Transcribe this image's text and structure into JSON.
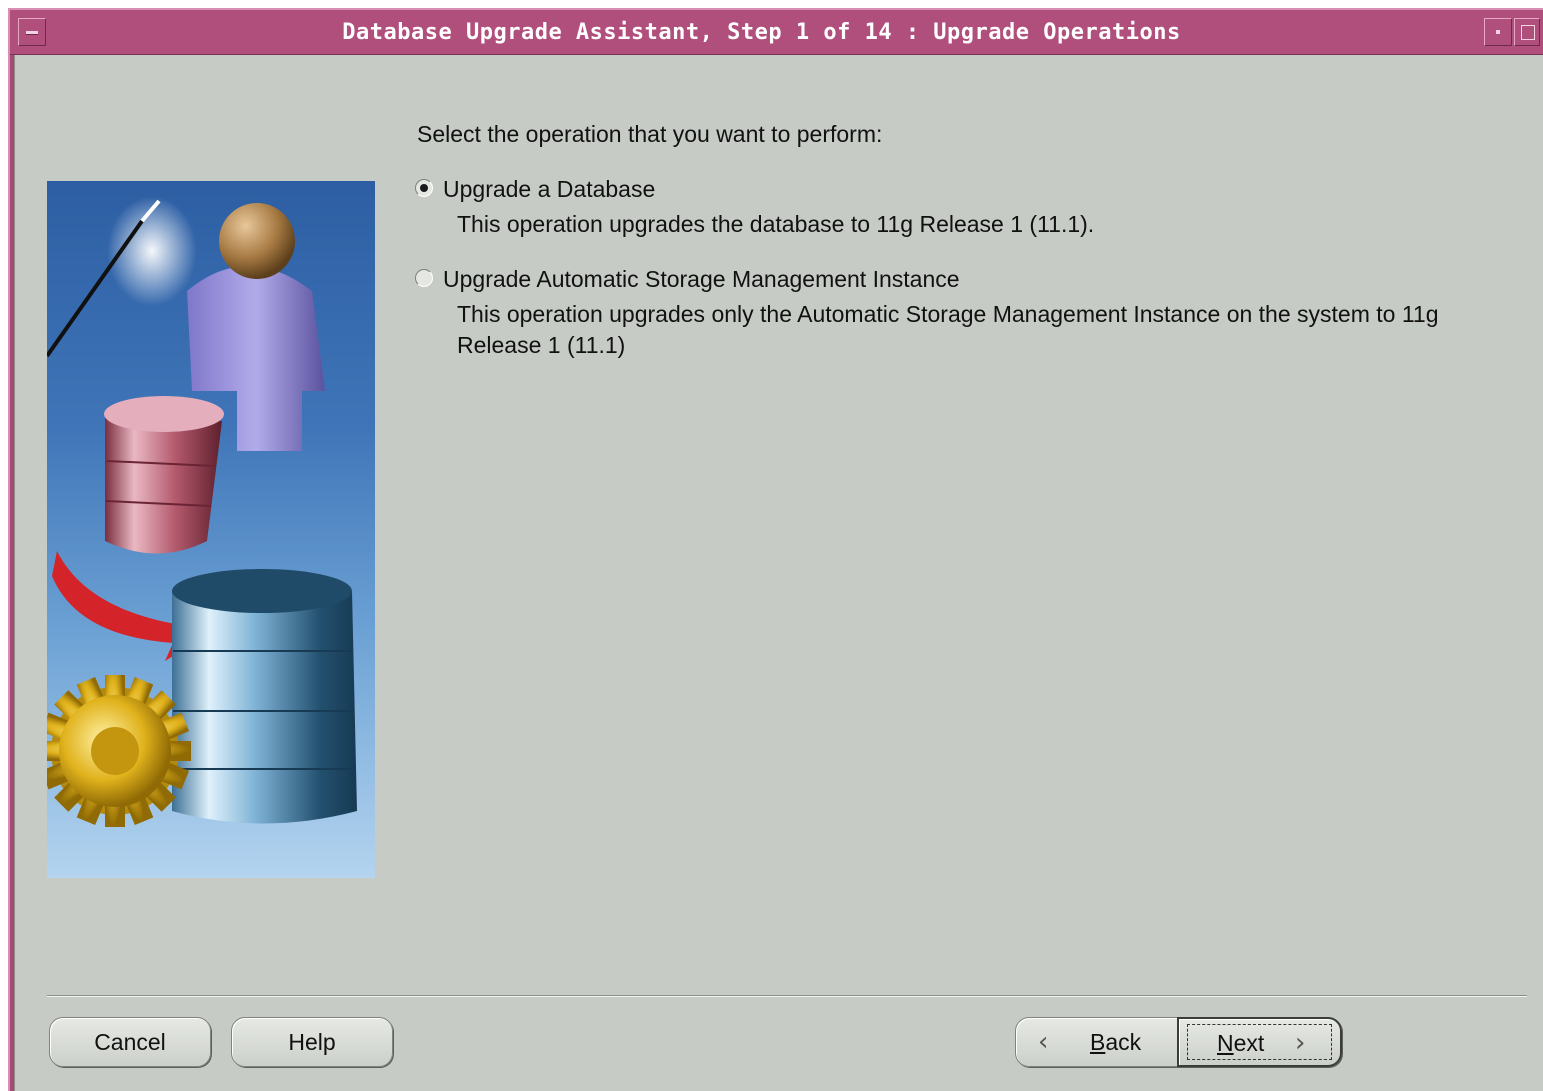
{
  "window": {
    "title": "Database Upgrade Assistant, Step 1 of 14 : Upgrade Operations"
  },
  "content": {
    "prompt": "Select the operation that you want to perform:",
    "options": [
      {
        "label": "Upgrade a Database",
        "description": "This operation upgrades the database to 11g Release 1 (11.1).",
        "selected": true
      },
      {
        "label": "Upgrade Automatic Storage Management Instance",
        "description": "This operation upgrades only the Automatic Storage Management Instance on the system to 11g Release 1 (11.1)",
        "selected": false
      }
    ]
  },
  "buttons": {
    "cancel": "Cancel",
    "help": "Help",
    "back_mnemonic": "B",
    "back_rest": "ack",
    "next_mnemonic": "N",
    "next_rest": "ext"
  },
  "icons": [
    "window-menu-icon",
    "minimize-icon",
    "maximize-icon",
    "back-chevron-icon",
    "next-chevron-icon"
  ],
  "colors": {
    "titlebar": "#b04f7c",
    "client_bg": "#c6cbc5"
  }
}
